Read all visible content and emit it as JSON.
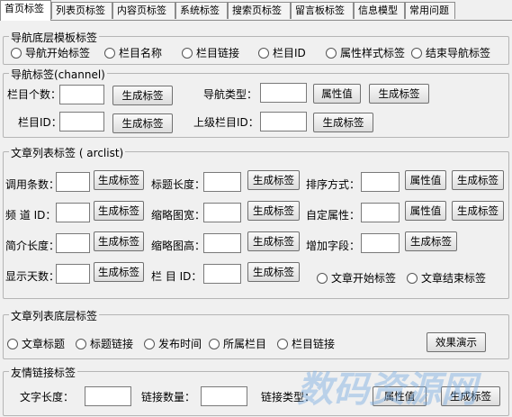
{
  "tabs": [
    "首页标签",
    "列表页标签",
    "内容页标签",
    "系统标签",
    "搜索页标签",
    "留言板标签",
    "信息模型",
    "常用问题"
  ],
  "nav_bottom": {
    "title": "导航底层模板标签",
    "radios": [
      "导航开始标签",
      "栏目名称",
      "栏目链接",
      "栏目ID",
      "属性样式标签",
      "结束导航标签"
    ]
  },
  "nav_channel": {
    "title": "导航标签(channel)",
    "count_label": "栏目个数：",
    "id_label": "栏目ID：",
    "type_label": "导航类型：",
    "parent_label": "上级栏目ID：",
    "gen_label": "生成标签",
    "attr_label": "属性值"
  },
  "arclist": {
    "title": "文章列表标签 ( arclist)",
    "call_label": "调用条数：",
    "channel_label": "频 道 ID：",
    "intro_label": "简介长度：",
    "days_label": "显示天数：",
    "titlelen_label": "标题长度：",
    "thumbw_label": "缩略图宽：",
    "thumbh_label": "缩略图高：",
    "colid_label": "栏 目 ID：",
    "order_label": "排序方式：",
    "custom_label": "自定属性：",
    "addfield_label": "增加字段：",
    "gen_label": "生成标签",
    "attr_label": "属性值",
    "start_radio": "文章开始标签",
    "end_radio": "文章结束标签"
  },
  "arclist_bottom": {
    "title": "文章列表底层标签",
    "radios": [
      "文章标题",
      "标题链接",
      "发布时间",
      "所属栏目",
      "栏目链接"
    ],
    "demo_label": "效果演示"
  },
  "friendlink": {
    "title": "友情链接标签",
    "textlen_label": "文字长度：",
    "count_label": "链接数量：",
    "type_label": "链接类型：",
    "attr_label": "属性值",
    "gen_label": "生成标签"
  },
  "watermark": "数码资源网"
}
